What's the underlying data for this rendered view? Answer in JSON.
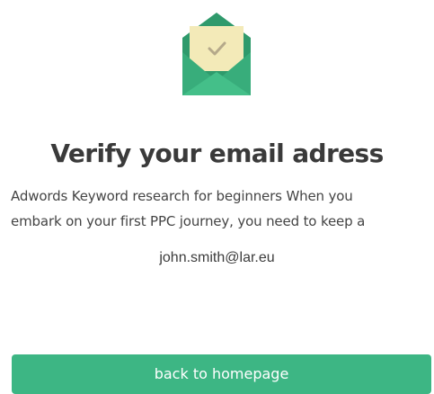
{
  "header": {
    "icon": "envelope-check-icon"
  },
  "title": "Verify your email adress",
  "body": {
    "line1": "Adwords Keyword research for beginners   When you",
    "line2": "embark on your first PPC journey, you need to keep a"
  },
  "email": "john.smith@lar.eu",
  "actions": {
    "back_label": "back to homepage"
  },
  "colors": {
    "accent": "#3db684",
    "envelope_dark": "#2f9a6c",
    "letter": "#f3eab8",
    "check": "#b5a98a"
  }
}
